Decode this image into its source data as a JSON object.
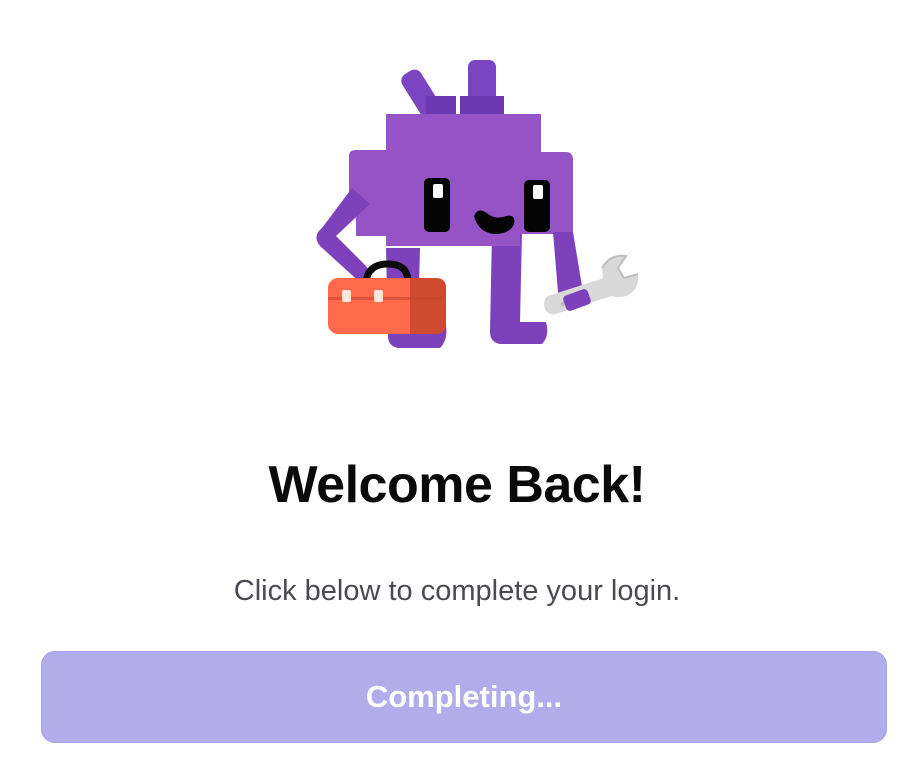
{
  "illustration": {
    "name": "mascot-with-toolbox-and-wrench",
    "colors": {
      "body": "#9553c6",
      "body_dark": "#7d42bb",
      "toolbox": "#ff6a4d",
      "toolbox_dark": "#d04a2f",
      "wrench": "#d8d8d8"
    }
  },
  "heading": "Welcome Back!",
  "subheading": "Click below to complete your login.",
  "button": {
    "label": "Completing...",
    "state": "disabled",
    "color": "#b3acea"
  }
}
